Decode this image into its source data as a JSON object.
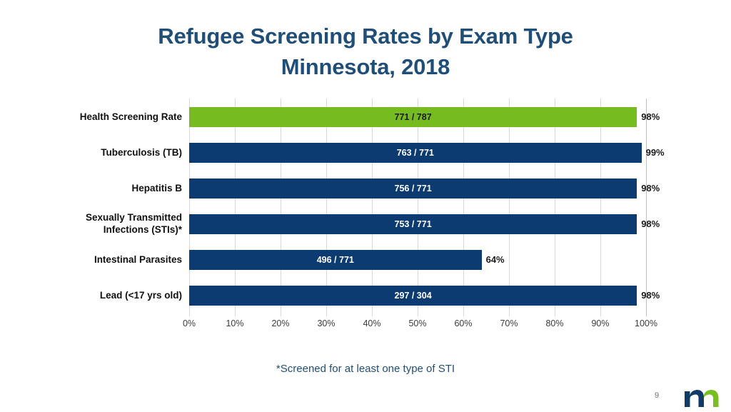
{
  "slide": {
    "title_line1": "Refugee Screening Rates by Exam Type",
    "title_line2": "Minnesota, 2018",
    "footnote": "*Screened for at least one type of STI",
    "page_number": "9",
    "logo_name": "mn-state-logo"
  },
  "colors": {
    "title": "#1F4E79",
    "bar_default": "#0C3B72",
    "bar_accent": "#76BC21",
    "gridline": "#d9d9d9",
    "axis_end": "#bfbfbf",
    "logo_navy": "#103B66",
    "logo_green": "#78BE20"
  },
  "chart_data": {
    "type": "bar",
    "orientation": "horizontal",
    "title": "Refugee Screening Rates by Exam Type Minnesota, 2018",
    "xlabel": "",
    "ylabel": "",
    "xlim": [
      0,
      100
    ],
    "grid": true,
    "legend": "none",
    "xticks": [
      "0%",
      "10%",
      "20%",
      "30%",
      "40%",
      "50%",
      "60%",
      "70%",
      "80%",
      "90%",
      "100%"
    ],
    "xtick_values": [
      0,
      10,
      20,
      30,
      40,
      50,
      60,
      70,
      80,
      90,
      100
    ],
    "categories": [
      "Health Screening Rate",
      "Tuberculosis (TB)",
      "Hepatitis B",
      "Sexually Transmitted Infections (STIs)*",
      "Intestinal Parasites",
      "Lead (<17 yrs old)"
    ],
    "values": [
      98,
      99,
      98,
      98,
      64,
      98
    ],
    "bars": [
      {
        "category": "Health Screening Rate",
        "category_line1": "Health Screening Rate",
        "category_line2": "",
        "value": 98,
        "percent_label": "98%",
        "value_label": "771 / 787",
        "numerator": 771,
        "denominator": 787,
        "highlight": true
      },
      {
        "category": "Tuberculosis (TB)",
        "category_line1": "Tuberculosis (TB)",
        "category_line2": "",
        "value": 99,
        "percent_label": "99%",
        "value_label": "763 / 771",
        "numerator": 763,
        "denominator": 771,
        "highlight": false
      },
      {
        "category": "Hepatitis B",
        "category_line1": "Hepatitis B",
        "category_line2": "",
        "value": 98,
        "percent_label": "98%",
        "value_label": "756 / 771",
        "numerator": 756,
        "denominator": 771,
        "highlight": false
      },
      {
        "category": "Sexually Transmitted Infections (STIs)*",
        "category_line1": "Sexually Transmitted",
        "category_line2": "Infections (STIs)*",
        "value": 98,
        "percent_label": "98%",
        "value_label": "753 / 771",
        "numerator": 753,
        "denominator": 771,
        "highlight": false
      },
      {
        "category": "Intestinal Parasites",
        "category_line1": "Intestinal Parasites",
        "category_line2": "",
        "value": 64,
        "percent_label": "64%",
        "value_label": "496 / 771",
        "numerator": 496,
        "denominator": 771,
        "highlight": false
      },
      {
        "category": "Lead (<17 yrs old)",
        "category_line1": "Lead (<17 yrs old)",
        "category_line2": "",
        "value": 98,
        "percent_label": "98%",
        "value_label": "297 / 304",
        "numerator": 297,
        "denominator": 304,
        "highlight": false
      }
    ]
  }
}
